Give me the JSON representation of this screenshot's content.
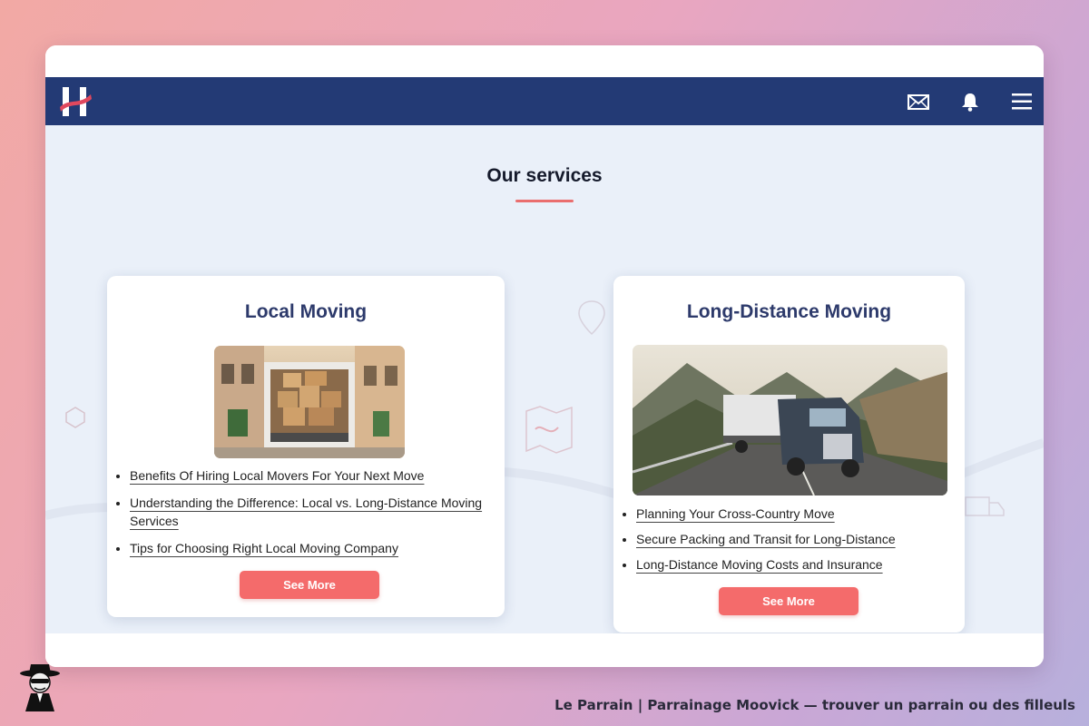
{
  "header": {
    "icons": [
      "logo-h-icon",
      "mail-icon",
      "bell-icon",
      "menu-icon"
    ]
  },
  "main": {
    "title": "Our services",
    "cards": [
      {
        "title": "Local Moving",
        "image": "moving-van-street-image",
        "links": [
          "Benefits Of Hiring Local Movers For Your Next Move",
          "Understanding the Difference: Local vs. Long-Distance Moving Services",
          "Tips for Choosing Right Local Moving Company"
        ],
        "button": "See More"
      },
      {
        "title": "Long-Distance Moving",
        "image": "semi-truck-mountain-road-image",
        "links": [
          "Planning Your Cross-Country Move",
          "Secure Packing and Transit for Long-Distance",
          "Long-Distance Moving Costs and Insurance"
        ],
        "button": "See More"
      }
    ]
  },
  "footer": {
    "caption": "Le Parrain | Parrainage Moovick — trouver un parrain ou des filleuls"
  },
  "colors": {
    "navbar": "#233a75",
    "accent": "#f46b6b",
    "card_title": "#2d3a6b",
    "main_bg": "#eaf0f9"
  }
}
